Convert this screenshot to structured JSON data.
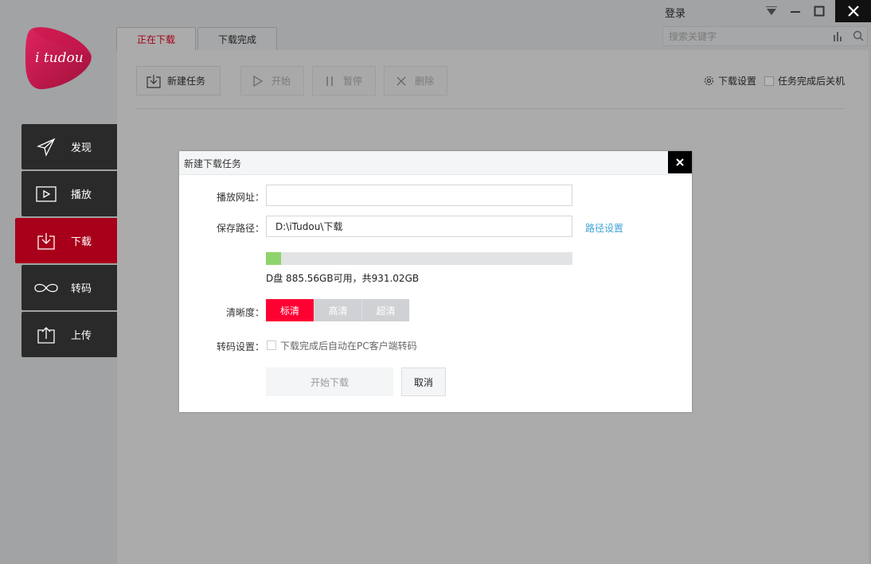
{
  "app": {
    "logo_text": "i tudou",
    "login_label": "登录"
  },
  "search": {
    "placeholder": "搜索关键字"
  },
  "sidebar": {
    "items": [
      {
        "label": "发现",
        "icon": "send-icon"
      },
      {
        "label": "播放",
        "icon": "play-icon"
      },
      {
        "label": "下载",
        "icon": "download-icon",
        "active": true
      },
      {
        "label": "转码",
        "icon": "infinity-icon"
      },
      {
        "label": "上传",
        "icon": "upload-icon"
      }
    ]
  },
  "tabs": [
    {
      "label": "正在下载",
      "active": true
    },
    {
      "label": "下载完成",
      "active": false
    }
  ],
  "toolbar": {
    "new_task": "新建任务",
    "start": "开始",
    "pause": "暂停",
    "delete": "删除",
    "download_settings": "下载设置",
    "shutdown_after": "任务完成后关机"
  },
  "dialog": {
    "title": "新建下载任务",
    "url_label": "播放网址：",
    "url_value": "",
    "path_label": "保存路径：",
    "path_value": "D:\\iTudou\\下载",
    "path_settings_link": "路径设置",
    "disk_usage_fraction": 0.049,
    "disk_text": "D盘 885.56GB可用，共931.02GB",
    "quality_label": "清晰度：",
    "quality_options": [
      "标清",
      "高清",
      "超清"
    ],
    "quality_selected": "标清",
    "transcode_label": "转码设置：",
    "transcode_option": "下载完成后自动在PC客户端转码",
    "start_button": "开始下载",
    "cancel_button": "取消"
  },
  "colors": {
    "accent_red": "#a8001a",
    "quality_active": "#ff0033",
    "link_blue": "#3fa3d4",
    "disk_fill": "#8fd36c"
  }
}
